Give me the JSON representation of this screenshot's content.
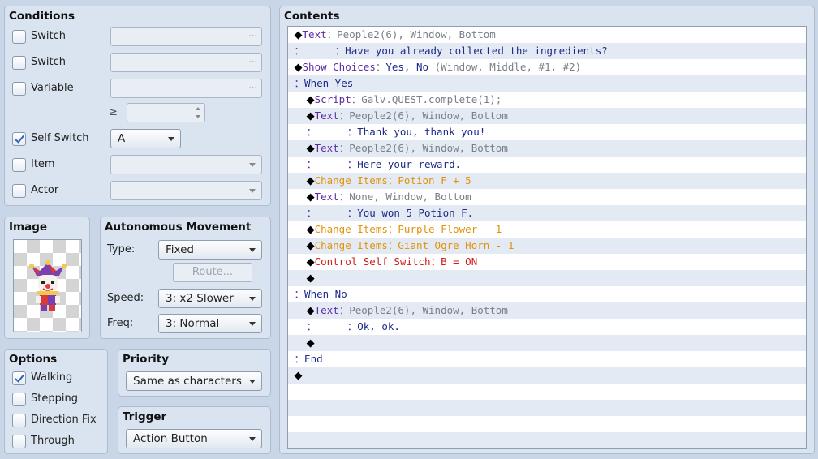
{
  "conditions": {
    "title": "Conditions",
    "switch1_label": "Switch",
    "switch2_label": "Switch",
    "variable_label": "Variable",
    "ge_symbol": "≥",
    "self_switch_label": "Self Switch",
    "self_switch_value": "A",
    "item_label": "Item",
    "actor_label": "Actor",
    "browse_dots": "..."
  },
  "image": {
    "title": "Image"
  },
  "autonomous": {
    "title": "Autonomous Movement",
    "type_label": "Type:",
    "type_value": "Fixed",
    "route_label": "Route...",
    "speed_label": "Speed:",
    "speed_value": "3: x2 Slower",
    "freq_label": "Freq:",
    "freq_value": "3: Normal"
  },
  "options": {
    "title": "Options",
    "walking": "Walking",
    "stepping": "Stepping",
    "direction_fix": "Direction Fix",
    "through": "Through"
  },
  "priority": {
    "title": "Priority",
    "value": "Same as characters"
  },
  "trigger": {
    "title": "Trigger",
    "value": "Action Button"
  },
  "contents": {
    "title": "Contents",
    "rows": [
      {
        "indent": "",
        "segs": [
          {
            "t": "◆",
            "c": "dia"
          },
          {
            "t": "Text",
            "c": "c-purple"
          },
          {
            "t": "：People2(6), Window, Bottom",
            "c": "c-gray"
          }
        ]
      },
      {
        "indent": "",
        "segs": [
          {
            "t": "：     ：",
            "c": "c-purple"
          },
          {
            "t": "Have you already collected the ingredients?",
            "c": "c-navy"
          }
        ]
      },
      {
        "indent": "",
        "segs": [
          {
            "t": "◆",
            "c": "dia"
          },
          {
            "t": "Show Choices",
            "c": "c-purple"
          },
          {
            "t": "：",
            "c": "c-gray"
          },
          {
            "t": "Yes, No",
            "c": "c-navy"
          },
          {
            "t": " (Window, Middle, #1, #2)",
            "c": "c-gray"
          }
        ]
      },
      {
        "indent": "",
        "segs": [
          {
            "t": "：",
            "c": "c-purple"
          },
          {
            "t": "When Yes",
            "c": "c-navy"
          }
        ]
      },
      {
        "indent": "  ",
        "segs": [
          {
            "t": "◆",
            "c": "dia"
          },
          {
            "t": "Script",
            "c": "c-purple"
          },
          {
            "t": "：Galv.QUEST.complete(1);",
            "c": "c-gray"
          }
        ]
      },
      {
        "indent": "  ",
        "segs": [
          {
            "t": "◆",
            "c": "dia"
          },
          {
            "t": "Text",
            "c": "c-purple"
          },
          {
            "t": "：People2(6), Window, Bottom",
            "c": "c-gray"
          }
        ]
      },
      {
        "indent": "  ",
        "segs": [
          {
            "t": "：     ：",
            "c": "c-purple"
          },
          {
            "t": "Thank you, thank you!",
            "c": "c-navy"
          }
        ]
      },
      {
        "indent": "  ",
        "segs": [
          {
            "t": "◆",
            "c": "dia"
          },
          {
            "t": "Text",
            "c": "c-purple"
          },
          {
            "t": "：People2(6), Window, Bottom",
            "c": "c-gray"
          }
        ]
      },
      {
        "indent": "  ",
        "segs": [
          {
            "t": "：     ：",
            "c": "c-purple"
          },
          {
            "t": "Here your reward.",
            "c": "c-navy"
          }
        ]
      },
      {
        "indent": "  ",
        "segs": [
          {
            "t": "◆",
            "c": "dia"
          },
          {
            "t": "Change Items",
            "c": "c-orange"
          },
          {
            "t": "：Potion F + 5",
            "c": "c-orange"
          }
        ]
      },
      {
        "indent": "  ",
        "segs": [
          {
            "t": "◆",
            "c": "dia"
          },
          {
            "t": "Text",
            "c": "c-purple"
          },
          {
            "t": "：None, Window, Bottom",
            "c": "c-gray"
          }
        ]
      },
      {
        "indent": "  ",
        "segs": [
          {
            "t": "：     ：",
            "c": "c-purple"
          },
          {
            "t": "You won 5 Potion F.",
            "c": "c-navy"
          }
        ]
      },
      {
        "indent": "  ",
        "segs": [
          {
            "t": "◆",
            "c": "dia"
          },
          {
            "t": "Change Items",
            "c": "c-orange"
          },
          {
            "t": "：Purple Flower - 1",
            "c": "c-orange"
          }
        ]
      },
      {
        "indent": "  ",
        "segs": [
          {
            "t": "◆",
            "c": "dia"
          },
          {
            "t": "Change Items",
            "c": "c-orange"
          },
          {
            "t": "：Giant Ogre Horn - 1",
            "c": "c-orange"
          }
        ]
      },
      {
        "indent": "  ",
        "segs": [
          {
            "t": "◆",
            "c": "dia"
          },
          {
            "t": "Control Self Switch",
            "c": "c-red"
          },
          {
            "t": "：B = ON",
            "c": "c-red"
          }
        ]
      },
      {
        "indent": "  ",
        "segs": [
          {
            "t": "◆",
            "c": "dia"
          }
        ]
      },
      {
        "indent": "",
        "segs": [
          {
            "t": "：",
            "c": "c-purple"
          },
          {
            "t": "When No",
            "c": "c-navy"
          }
        ]
      },
      {
        "indent": "  ",
        "segs": [
          {
            "t": "◆",
            "c": "dia"
          },
          {
            "t": "Text",
            "c": "c-purple"
          },
          {
            "t": "：People2(6), Window, Bottom",
            "c": "c-gray"
          }
        ]
      },
      {
        "indent": "  ",
        "segs": [
          {
            "t": "：     ：",
            "c": "c-purple"
          },
          {
            "t": "Ok, ok.",
            "c": "c-navy"
          }
        ]
      },
      {
        "indent": "  ",
        "segs": [
          {
            "t": "◆",
            "c": "dia"
          }
        ]
      },
      {
        "indent": "",
        "segs": [
          {
            "t": "：",
            "c": "c-purple"
          },
          {
            "t": "End",
            "c": "c-navy"
          }
        ]
      },
      {
        "indent": "",
        "segs": [
          {
            "t": "◆",
            "c": "dia"
          }
        ]
      },
      {
        "indent": "",
        "segs": []
      },
      {
        "indent": "",
        "segs": []
      },
      {
        "indent": "",
        "segs": []
      },
      {
        "indent": "",
        "segs": []
      }
    ]
  }
}
